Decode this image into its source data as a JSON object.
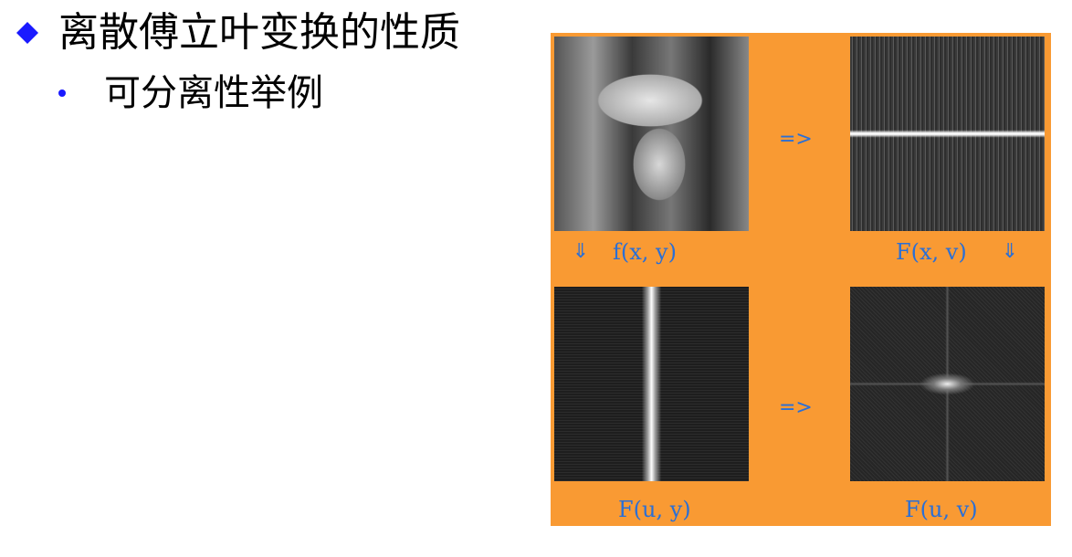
{
  "heading": "离散傅立叶变换的性质",
  "subheading": "可分离性举例",
  "colors": {
    "panel": "#F99A33",
    "label": "#2a6fd6",
    "bullet": "#1a1aff"
  },
  "figure": {
    "labels": {
      "fxy": "f(x, y)",
      "fxv": "F(x, v)",
      "fuy": "F(u, y)",
      "fuv": "F(u, v)"
    },
    "arrow_right": "=>",
    "arrow_down": "⇓"
  }
}
